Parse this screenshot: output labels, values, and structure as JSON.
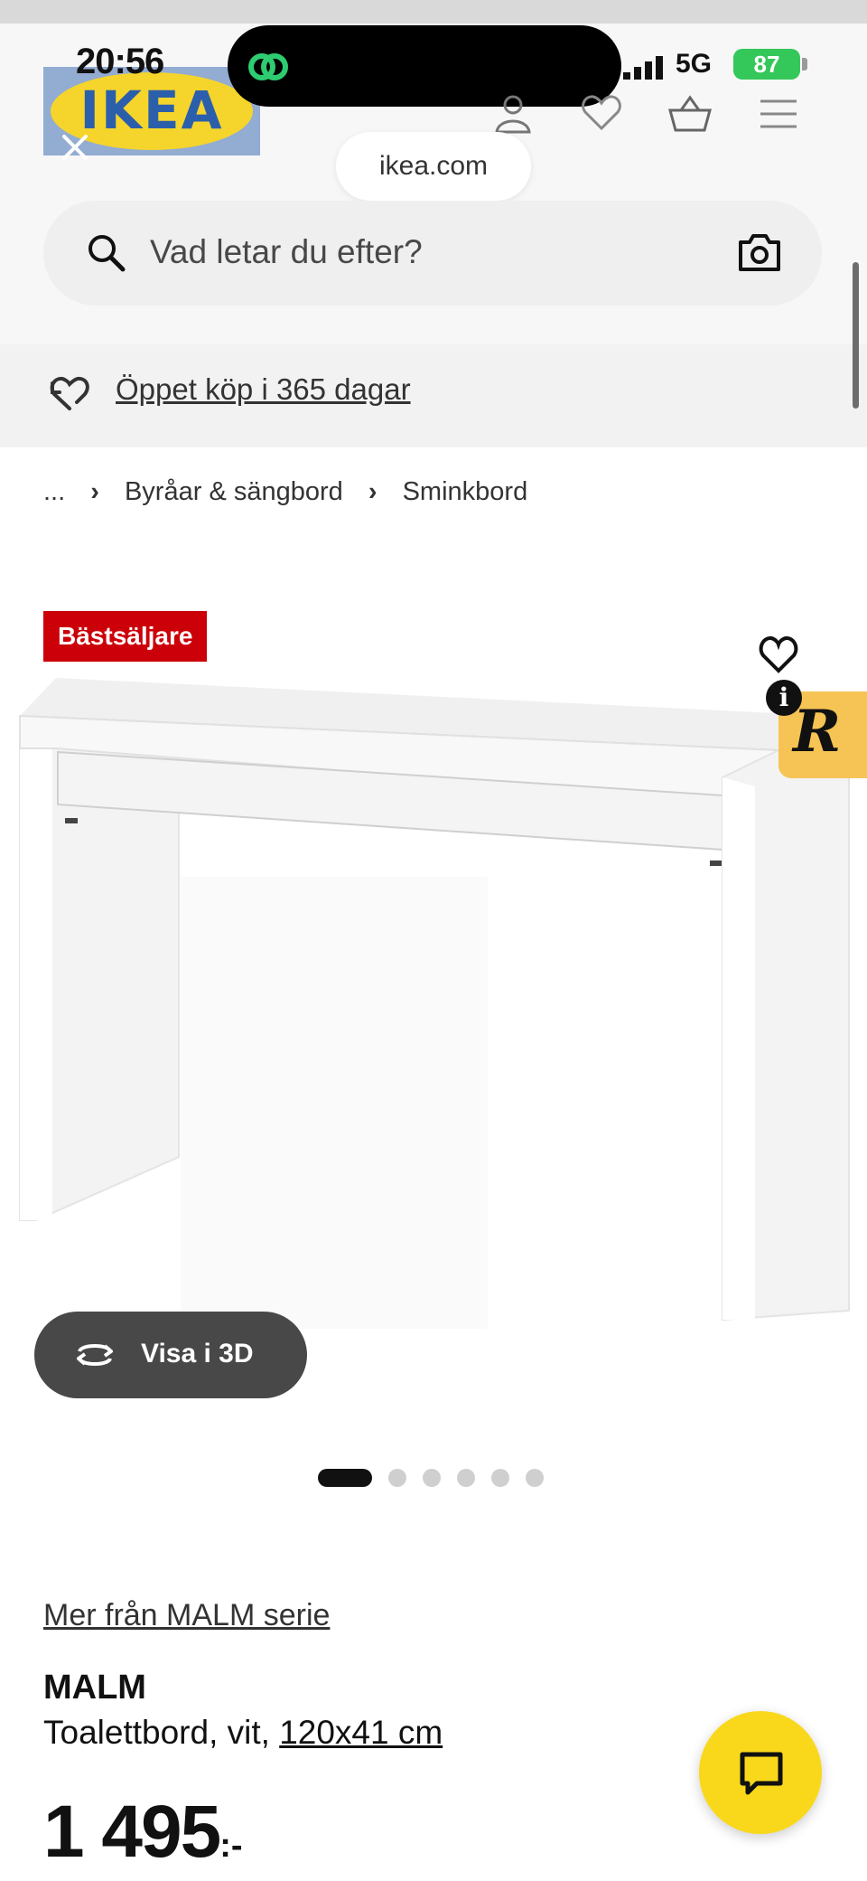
{
  "status_bar": {
    "time": "20:56",
    "network": "5G",
    "battery": "87"
  },
  "header": {
    "logo_text": "IKEA",
    "url": "ikea.com"
  },
  "search": {
    "placeholder": "Vad letar du efter?"
  },
  "return_banner": {
    "text": "Öppet köp i 365 dagar"
  },
  "breadcrumb": {
    "items": [
      "...",
      "Byråar & sängbord",
      "Sminkbord"
    ],
    "separator": "›"
  },
  "product": {
    "badge": "Bästsäljare",
    "info_label": "i",
    "r_label": "R",
    "view_3d_label": "Visa i 3D",
    "image_count": 6,
    "active_image": 1,
    "series_link": "Mer från MALM serie",
    "name": "MALM",
    "description": "Toalettbord, vit, ",
    "dimensions": "120x41 cm",
    "price": "1 495",
    "price_suffix": ":-"
  },
  "colors": {
    "badge_red": "#cc0008",
    "chat_yellow": "#f9d81b",
    "r_tab": "#f6c454",
    "battery_green": "#34c759"
  }
}
